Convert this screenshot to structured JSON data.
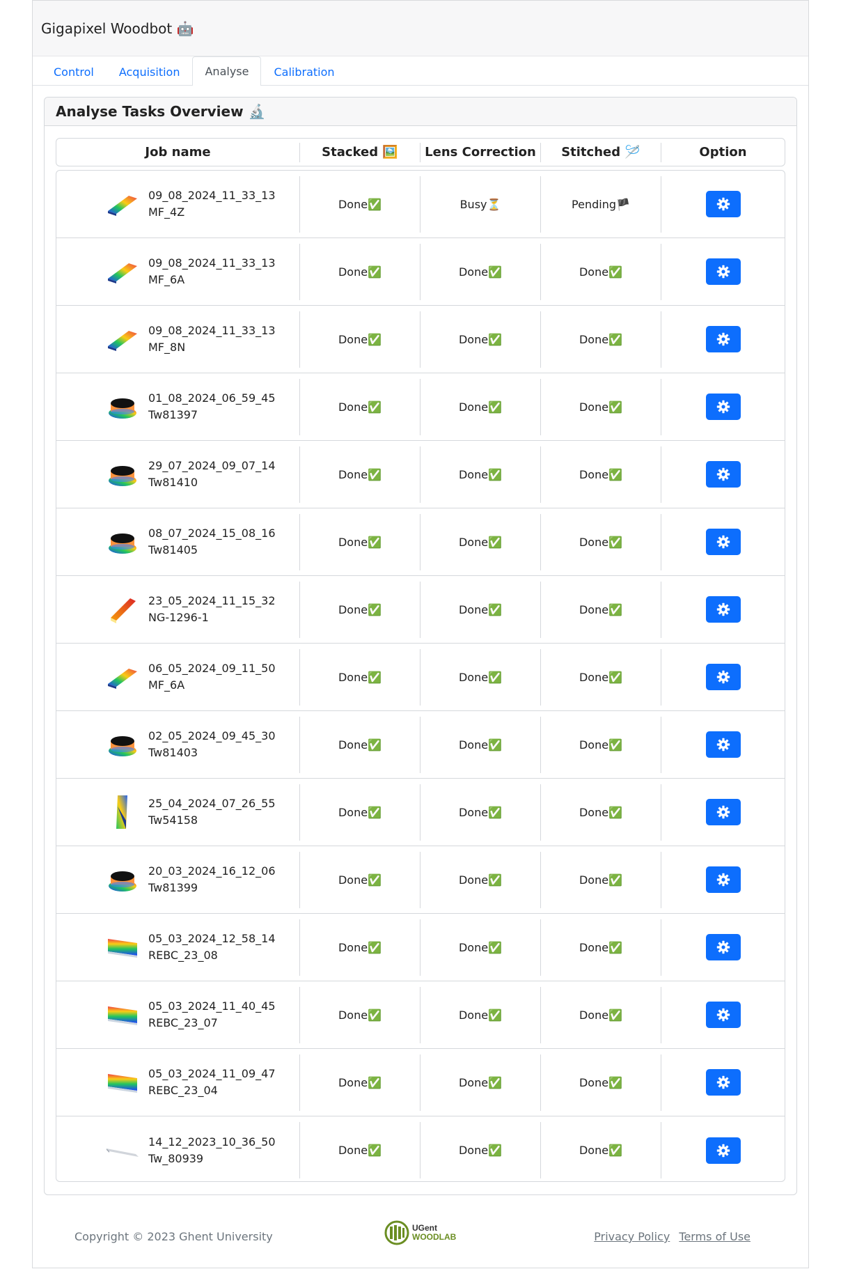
{
  "app": {
    "title": "Gigapixel Woodbot 🤖"
  },
  "tabs": [
    {
      "label": "Control"
    },
    {
      "label": "Acquisition"
    },
    {
      "label": "Analyse"
    },
    {
      "label": "Calibration"
    }
  ],
  "active_tab": "Analyse",
  "card": {
    "title": "Analyse Tasks Overview 🔬"
  },
  "columns": [
    "Job name",
    "Stacked 🖼️",
    "Lens Correction",
    "Stitched 🪡",
    "Option"
  ],
  "jobs": [
    {
      "date": "09_08_2024_11_33_13",
      "name": "MF_4Z",
      "stacked": "Done✅",
      "lens": "Busy⏳",
      "stitched": "Pending🏴",
      "thumb": "flat-ramp"
    },
    {
      "date": "09_08_2024_11_33_13",
      "name": "MF_6A",
      "stacked": "Done✅",
      "lens": "Done✅",
      "stitched": "Done✅",
      "thumb": "flat-ramp"
    },
    {
      "date": "09_08_2024_11_33_13",
      "name": "MF_8N",
      "stacked": "Done✅",
      "lens": "Done✅",
      "stitched": "Done✅",
      "thumb": "flat-ramp"
    },
    {
      "date": "01_08_2024_06_59_45",
      "name": "Tw81397",
      "stacked": "Done✅",
      "lens": "Done✅",
      "stitched": "Done✅",
      "thumb": "disc-stack"
    },
    {
      "date": "29_07_2024_09_07_14",
      "name": "Tw81410",
      "stacked": "Done✅",
      "lens": "Done✅",
      "stitched": "Done✅",
      "thumb": "disc-stack"
    },
    {
      "date": "08_07_2024_15_08_16",
      "name": "Tw81405",
      "stacked": "Done✅",
      "lens": "Done✅",
      "stitched": "Done✅",
      "thumb": "disc-stack"
    },
    {
      "date": "23_05_2024_11_15_32",
      "name": "NG-1296-1",
      "stacked": "Done✅",
      "lens": "Done✅",
      "stitched": "Done✅",
      "thumb": "bar-orange"
    },
    {
      "date": "06_05_2024_09_11_50",
      "name": "MF_6A",
      "stacked": "Done✅",
      "lens": "Done✅",
      "stitched": "Done✅",
      "thumb": "flat-ramp"
    },
    {
      "date": "02_05_2024_09_45_30",
      "name": "Tw81403",
      "stacked": "Done✅",
      "lens": "Done✅",
      "stitched": "Done✅",
      "thumb": "disc-stack"
    },
    {
      "date": "25_04_2024_07_26_55",
      "name": "Tw54158",
      "stacked": "Done✅",
      "lens": "Done✅",
      "stitched": "Done✅",
      "thumb": "tall-slab"
    },
    {
      "date": "20_03_2024_16_12_06",
      "name": "Tw81399",
      "stacked": "Done✅",
      "lens": "Done✅",
      "stitched": "Done✅",
      "thumb": "disc-stack"
    },
    {
      "date": "05_03_2024_12_58_14",
      "name": "REBC_23_08",
      "stacked": "Done✅",
      "lens": "Done✅",
      "stitched": "Done✅",
      "thumb": "wide-slab"
    },
    {
      "date": "05_03_2024_11_40_45",
      "name": "REBC_23_07",
      "stacked": "Done✅",
      "lens": "Done✅",
      "stitched": "Done✅",
      "thumb": "wide-slab"
    },
    {
      "date": "05_03_2024_11_09_47",
      "name": "REBC_23_04",
      "stacked": "Done✅",
      "lens": "Done✅",
      "stitched": "Done✅",
      "thumb": "wide-slab"
    },
    {
      "date": "14_12_2023_10_36_50",
      "name": "Tw_80939",
      "stacked": "Done✅",
      "lens": "Done✅",
      "stitched": "Done✅",
      "thumb": "thin-sliver"
    }
  ],
  "footer": {
    "copyright": "Copyright © 2023 Ghent University",
    "logo_line1": "UGent",
    "logo_line2": "WOODLAB",
    "privacy": "Privacy Policy",
    "terms": "Terms of Use"
  },
  "colors": {
    "primary": "#0d6efd",
    "border": "#d5d8dc",
    "header_bg": "#f7f7f8"
  },
  "icons": {
    "option_button": "gear-icon"
  }
}
